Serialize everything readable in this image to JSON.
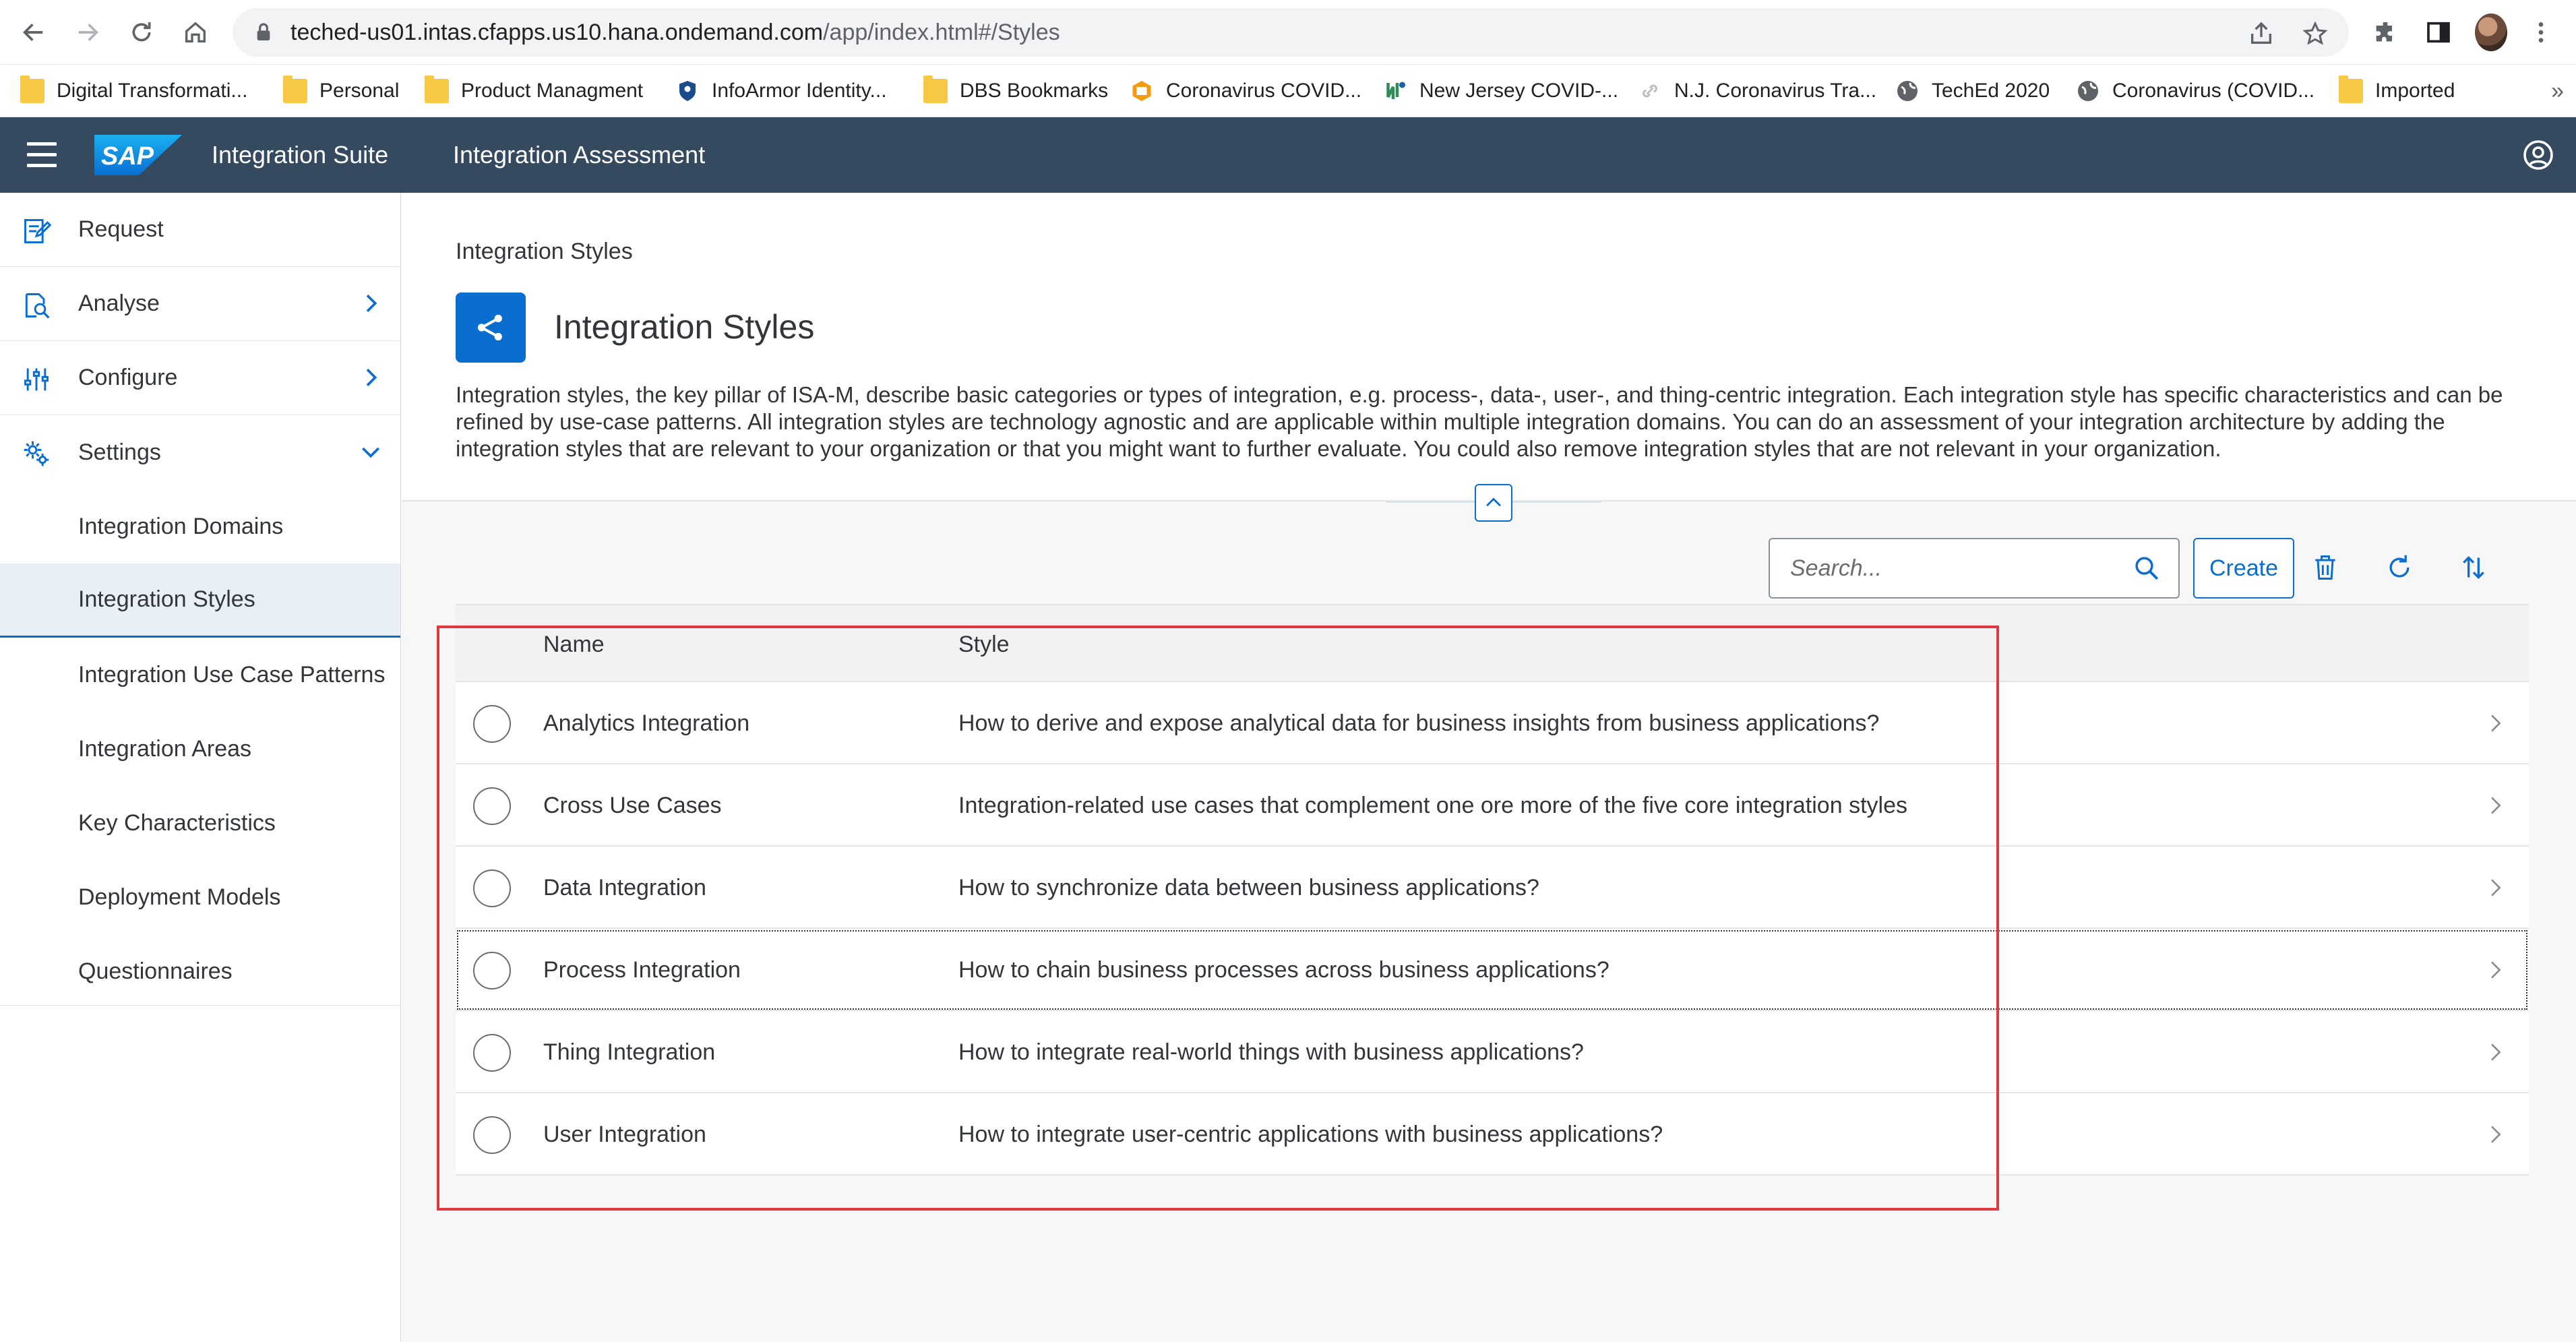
{
  "browser": {
    "url_host": "teched-us01.intas.cfapps.us10.hana.ondemand.com",
    "url_path": "/app/index.html#/Styles",
    "bookmarks": [
      {
        "label": "Digital Transformati...",
        "icon": "folder-icon"
      },
      {
        "label": "Personal",
        "icon": "folder-icon"
      },
      {
        "label": "Product Managment",
        "icon": "folder-icon"
      },
      {
        "label": "InfoArmor Identity...",
        "icon": "shield-icon"
      },
      {
        "label": "DBS Bookmarks",
        "icon": "folder-icon"
      },
      {
        "label": "Coronavirus COVID...",
        "icon": "covid-icon"
      },
      {
        "label": "New Jersey COVID-...",
        "icon": "nj-icon"
      },
      {
        "label": "N.J. Coronavirus Tra...",
        "icon": "link-icon"
      },
      {
        "label": "TechEd 2020",
        "icon": "globe-icon"
      },
      {
        "label": "Coronavirus (COVID...",
        "icon": "globe-icon"
      },
      {
        "label": "Imported",
        "icon": "folder-icon"
      }
    ],
    "more": "»"
  },
  "shell": {
    "logo": "SAP",
    "product": "Integration Suite",
    "app": "Integration Assessment"
  },
  "sidenav": {
    "items": [
      {
        "label": "Request",
        "icon": "request-icon"
      },
      {
        "label": "Analyse",
        "icon": "analyse-icon"
      },
      {
        "label": "Configure",
        "icon": "configure-icon"
      },
      {
        "label": "Settings",
        "icon": "settings-icon"
      }
    ],
    "sub_items": [
      {
        "label": "Integration Domains"
      },
      {
        "label": "Integration Styles"
      },
      {
        "label": "Integration Use Case Patterns"
      },
      {
        "label": "Integration Areas"
      },
      {
        "label": "Key Characteristics"
      },
      {
        "label": "Deployment Models"
      },
      {
        "label": "Questionnaires"
      }
    ],
    "selected": "Integration Styles"
  },
  "page": {
    "breadcrumb": "Integration Styles",
    "title": "Integration Styles",
    "description": "Integration styles, the key pillar of ISA-M, describe basic categories or types of integration, e.g. process-, data-, user-, and thing-centric integration. Each integration style has specific characteristics and can be refined by use-case patterns. All integration styles are technology agnostic and are applicable within multiple integration domains. You can do an assessment of your integration architecture by adding the integration styles that are relevant to your organization or that you might want to further evaluate. You could also remove integration styles that are not relevant in your organization."
  },
  "toolbar": {
    "search_placeholder": "Search...",
    "create_label": "Create"
  },
  "table": {
    "columns": [
      "Name",
      "Style"
    ],
    "rows": [
      {
        "name": "Analytics Integration",
        "style": "How to derive and expose analytical data for business insights from business applications?"
      },
      {
        "name": "Cross Use Cases",
        "style": "Integration-related use cases that complement one ore more of the five core integration styles"
      },
      {
        "name": "Data Integration",
        "style": "How to synchronize data between business applications?"
      },
      {
        "name": "Process Integration",
        "style": "How to chain business processes across business applications?"
      },
      {
        "name": "Thing Integration",
        "style": "How to integrate real-world things with business applications?"
      },
      {
        "name": "User Integration",
        "style": "How to integrate user-centric applications with business applications?"
      }
    ],
    "focused_row": "Process Integration"
  },
  "colors": {
    "shell": "#354a5f",
    "accent": "#0a6ed1",
    "highlight": "#e0383e"
  }
}
